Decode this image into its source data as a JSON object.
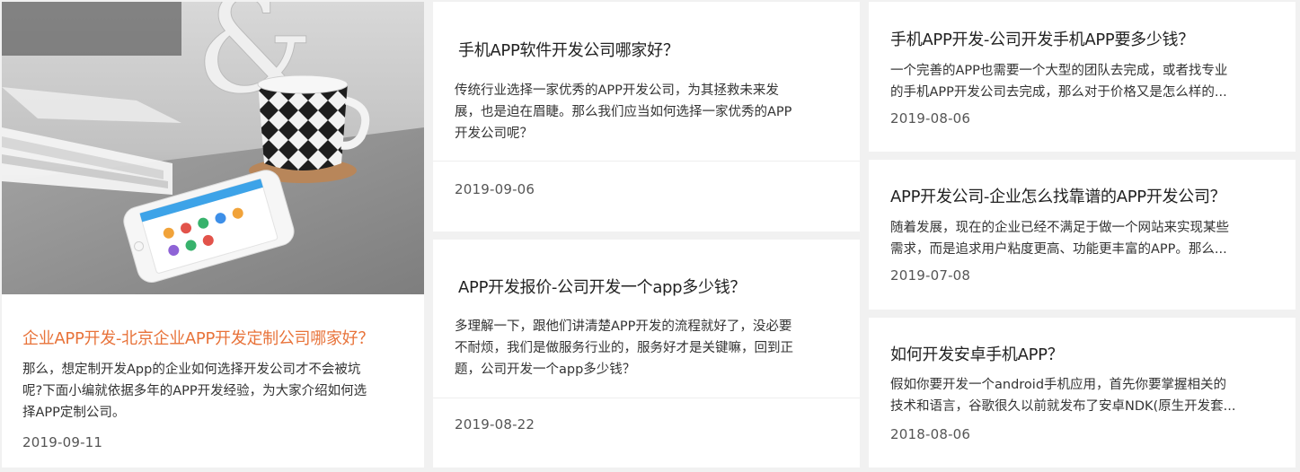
{
  "featured": {
    "title": "企业APP开发-北京企业APP开发定制公司哪家好？",
    "desc_lines": [
      "那么，想定制开发App的企业如何选择开发公司才不会被坑",
      "呢?下面小编就依据多年的APP开发经验，为大家介绍如何选",
      "择APP定制公司。"
    ],
    "date": "2019-09-11",
    "title_color": "#e8733a",
    "image_icon": "phone-coffee-photo"
  },
  "middle": [
    {
      "title": "手机APP软件开发公司哪家好？",
      "desc_lines": [
        "传统行业选择一家优秀的APP开发公司，为其拯救未来发",
        "展，也是迫在眉睫。那么我们应当如何选择一家优秀的APP",
        "开发公司呢？"
      ],
      "date": "2019-09-06"
    },
    {
      "title": "APP开发报价-公司开发一个app多少钱？",
      "desc_lines": [
        "多理解一下，跟他们讲清楚APP开发的流程就好了，没必要",
        "不耐烦，我们是做服务行业的，服务好才是关键嘛，回到正",
        "题，公司开发一个app多少钱？"
      ],
      "date": "2019-08-22"
    }
  ],
  "right": [
    {
      "title": "手机APP开发-公司开发手机APP要多少钱？",
      "desc_lines": [
        "一个完善的APP也需要一个大型的团队去完成，或者找专业",
        "的手机APP开发公司去完成，那么对于价格又是怎么样的..."
      ],
      "date": "2019-08-06"
    },
    {
      "title": "APP开发公司-企业怎么找靠谱的APP开发公司？",
      "desc_lines": [
        "随着发展，现在的企业已经不满足于做一个网站来实现某些",
        "需求，而是追求用户粘度更高、功能更丰富的APP。那么..."
      ],
      "date": "2019-07-08"
    },
    {
      "title": "如何开发安卓手机APP？",
      "desc_lines": [
        "假如你要开发一个android手机应用，首先你要掌握相关的",
        "技术和语言，谷歌很久以前就发布了安卓NDK(原生开发套..."
      ],
      "date": "2018-08-06"
    }
  ]
}
